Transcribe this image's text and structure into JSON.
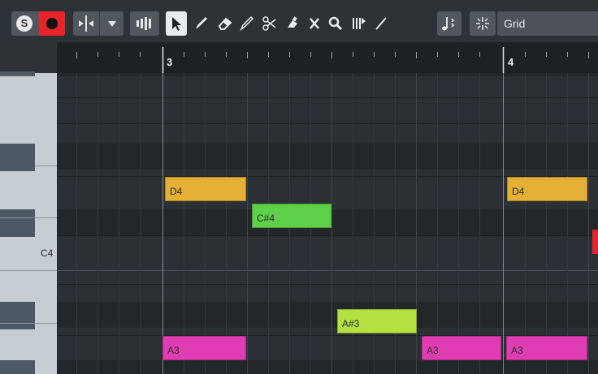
{
  "toolbar": {
    "solo_label": "S",
    "grid_type": "Grid",
    "tools": [
      "record-button",
      "auto-scroll-icon",
      "dropdown-icon",
      "acoustic-feedback-icon",
      "object-selection-tool",
      "draw-tool",
      "erase-tool",
      "line-tool",
      "split-tool",
      "glue-tool",
      "mute-tool",
      "zoom-tool",
      "time-warp-tool",
      "draw-velocity-tool",
      "show-note-expression-icon",
      "snap-icon"
    ]
  },
  "ruler": {
    "bars": [
      "3",
      "4"
    ]
  },
  "keyboard": {
    "c4_label": "C4"
  },
  "notes": [
    {
      "pitch": "D4",
      "label": "D4",
      "color": "#e4b035"
    },
    {
      "pitch": "C#4",
      "label": "C#4",
      "color": "#5fd04a"
    },
    {
      "pitch": "D4",
      "label": "D4",
      "color": "#e4b035"
    },
    {
      "pitch": "A#3",
      "label": "A#3",
      "color": "#b4e040"
    },
    {
      "pitch": "A3",
      "label": "A3",
      "color": "#e03cb4"
    },
    {
      "pitch": "A3",
      "label": "A3",
      "color": "#e03cb4"
    },
    {
      "pitch": "A3",
      "label": "A3",
      "color": "#e03cb4"
    }
  ],
  "colors": {
    "accent_red": "#e8242a",
    "note_d4": "#e4b035",
    "note_cs4": "#5fd04a",
    "note_as3": "#b4e040",
    "note_a3": "#e03cb4"
  }
}
